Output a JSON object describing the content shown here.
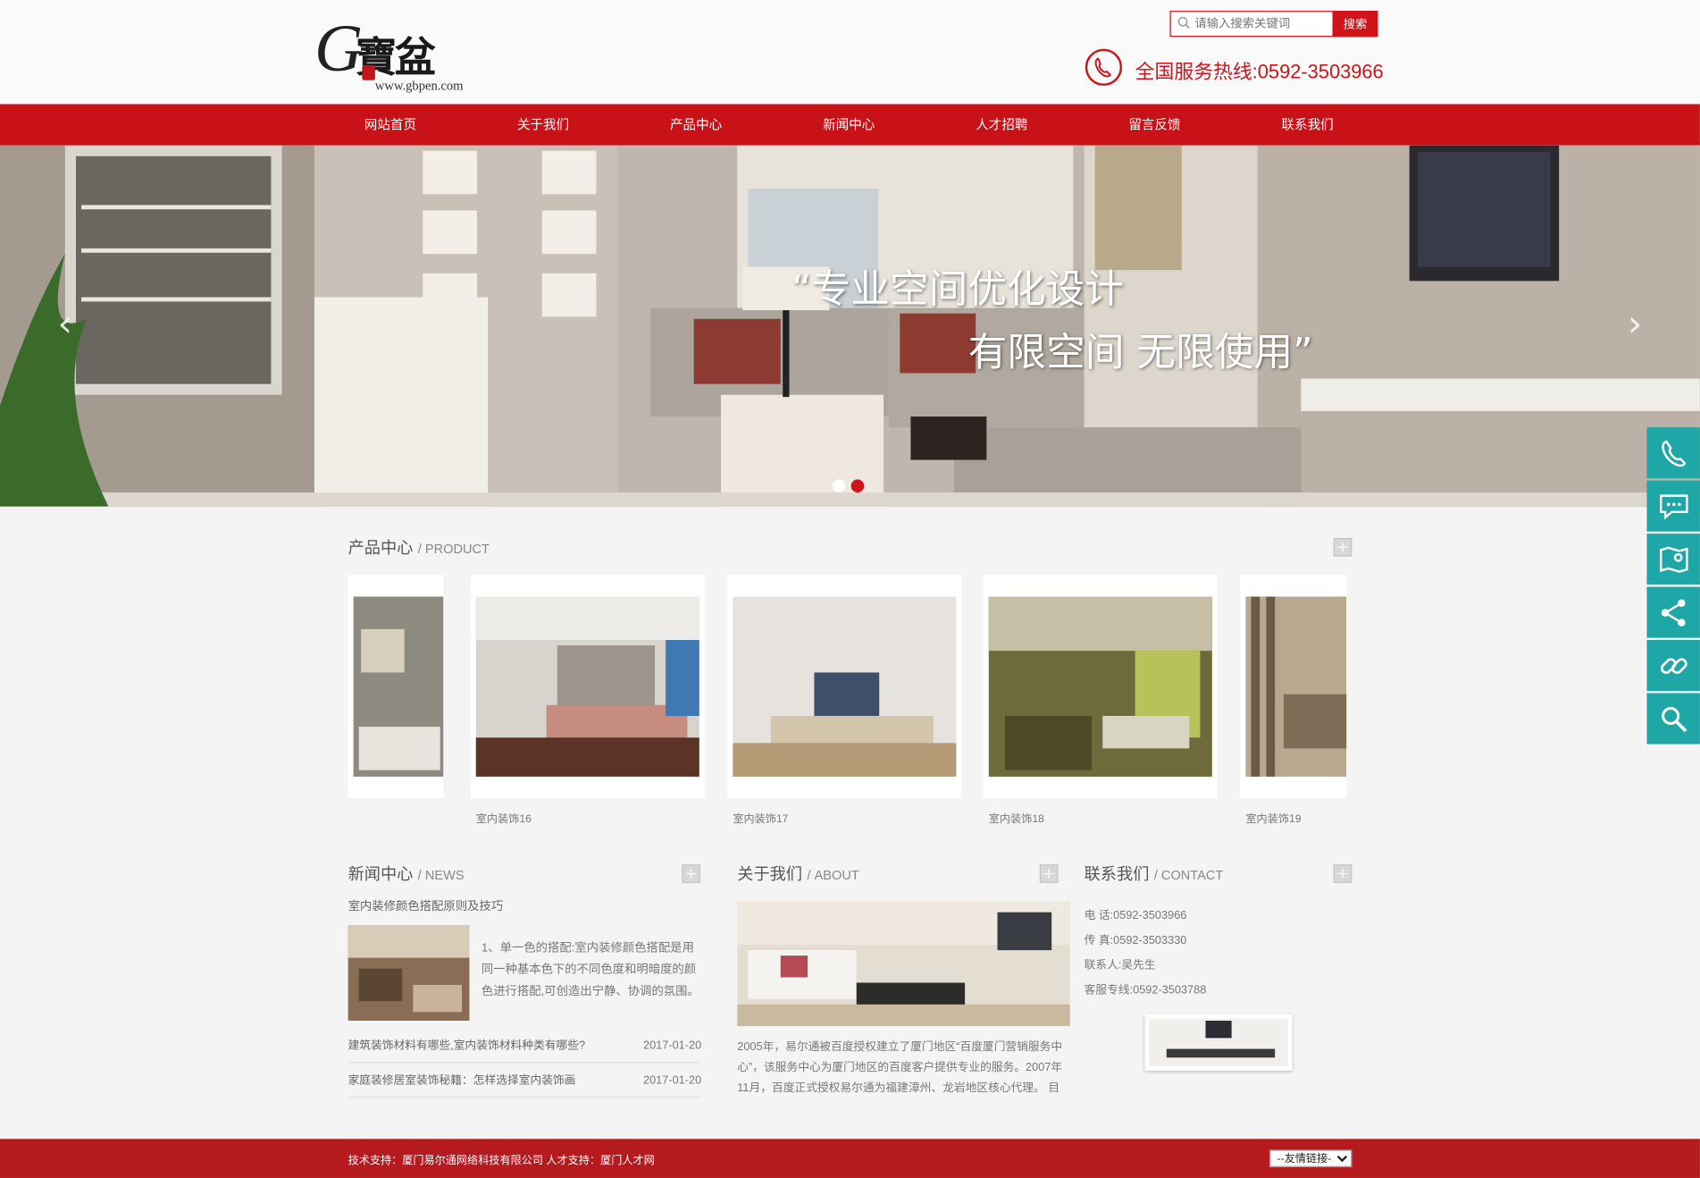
{
  "header": {
    "logo_letter": "G",
    "logo_chars": "寶盆",
    "logo_url": "www.gbpen.com",
    "search_placeholder": "请输入搜索关键词",
    "search_button": "搜索",
    "hotline": "全国服务热线:0592-3503966"
  },
  "nav": [
    "网站首页",
    "关于我们",
    "产品中心",
    "新闻中心",
    "人才招聘",
    "留言反馈",
    "联系我们"
  ],
  "banner": {
    "line1": "“专业空间优化设计",
    "line2": "有限空间 无限使用”",
    "prev": "‹",
    "next": "›"
  },
  "products": {
    "title_cn": "产品中心",
    "title_en": "/ PRODUCT",
    "items": [
      "室内装饰16",
      "室内装饰17",
      "室内装饰18",
      "室内装饰19"
    ]
  },
  "news": {
    "title_cn": "新闻中心",
    "title_en": "/ NEWS",
    "top_title": "室内装修颜色搭配原则及技巧",
    "top_summary": "1、单一色的搭配:室内装修颜色搭配是用同一种基本色下的不同色度和明暗度的颜色进行搭配,可创造出宁静、协调的氛围。此种搭配多用",
    "list": [
      {
        "title": "建筑装饰材料有哪些,室内装饰材料种类有哪些?",
        "date": "2017-01-20"
      },
      {
        "title": "家庭装修居室装饰秘籍：怎样选择室内装饰画",
        "date": "2017-01-20"
      }
    ]
  },
  "about": {
    "title_cn": "关于我们",
    "title_en": "/ ABOUT",
    "text": "2005年，易尔通被百度授权建立了厦门地区“百度厦门营销服务中心”，该服务中心为厦门地区的百度客户提供专业的服务。2007年11月，百度正式授权易尔通为福建漳州、龙岩地区核心代理。 目前"
  },
  "contact": {
    "title_cn": "联系我们",
    "title_en": "/ CONTACT",
    "lines": [
      "电 话:0592-3503966",
      "传 真:0592-3503330",
      "联系人:吴先生",
      "客服专线:0592-3503788"
    ]
  },
  "footer": {
    "text": "技术支持：厦门易尔通网络科技有限公司 人才支持：厦门人才网",
    "links_select": "--友情链接--"
  },
  "sidebar": [
    "phone-icon",
    "message-icon",
    "map-icon",
    "share-icon",
    "link-icon",
    "search-icon"
  ],
  "colors": {
    "brand_red": "#c81217",
    "footer_red": "#b51a1f",
    "side_teal": "#1fa7a7"
  }
}
